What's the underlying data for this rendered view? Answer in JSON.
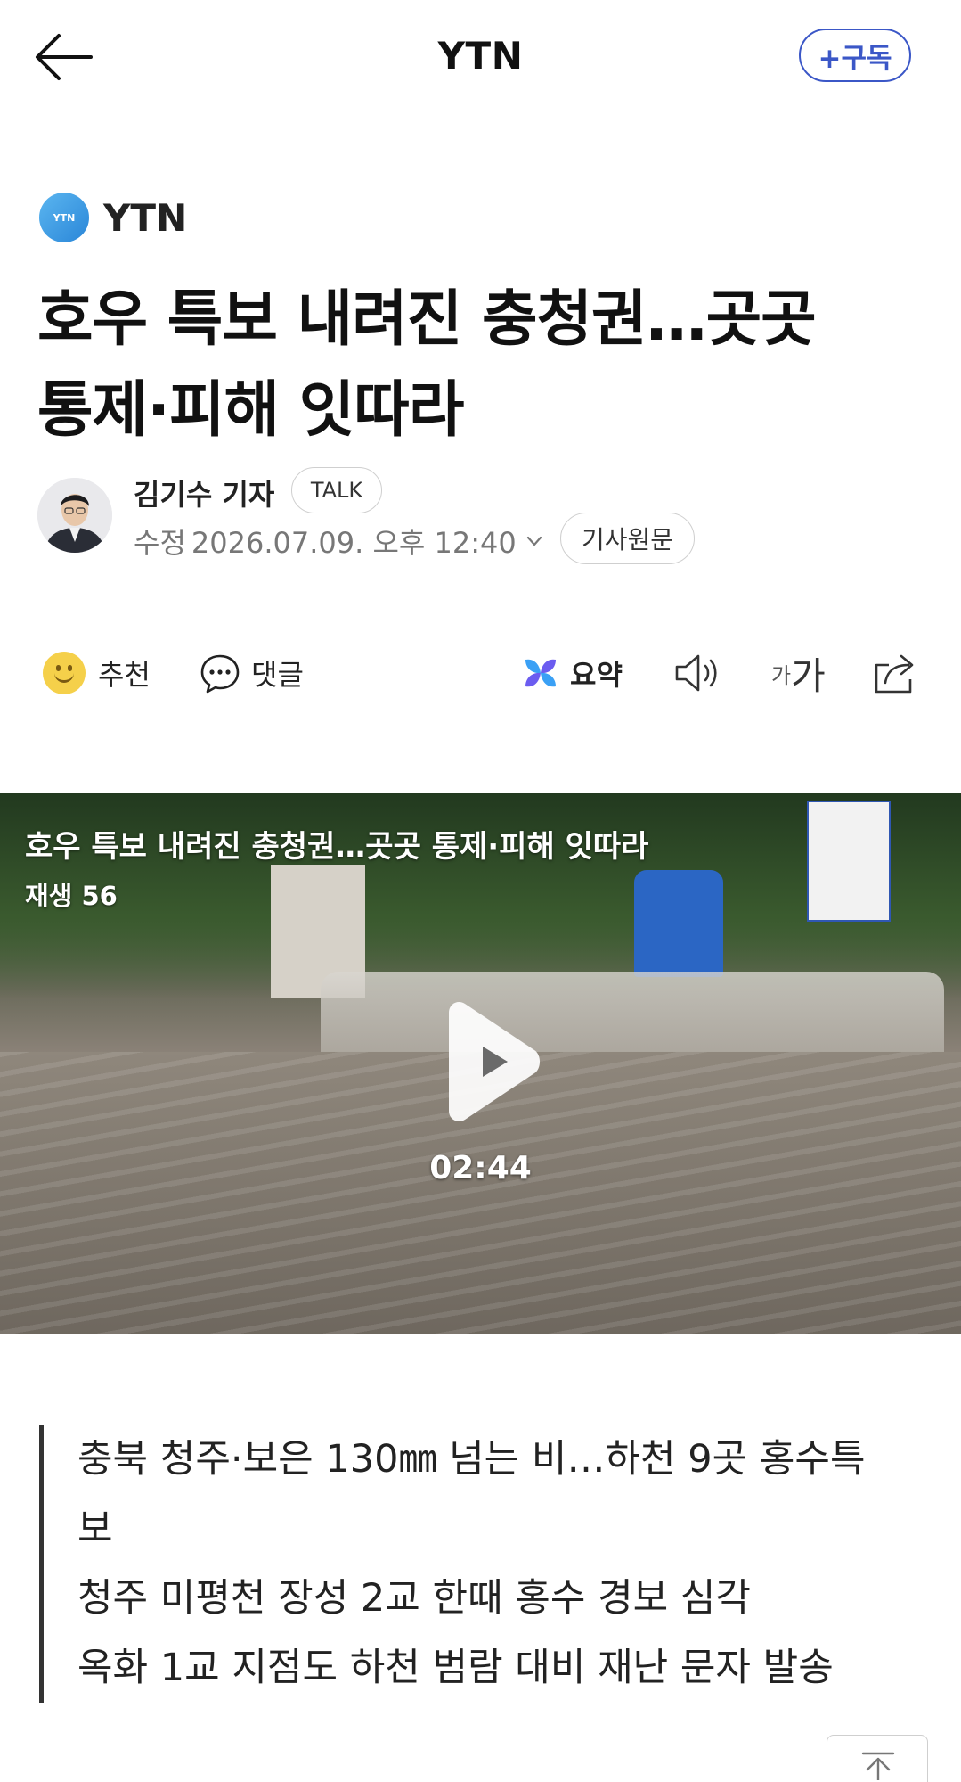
{
  "topbar": {
    "title": "YTN",
    "subscribe_label": "+구독"
  },
  "press": {
    "logo_text": "YTN",
    "name": "YTN"
  },
  "article": {
    "headline_line1": "호우 특보 내려진 충청권…곳곳",
    "headline_line2": "통제·피해 잇따라",
    "author": "김기수 기자",
    "talk_label": "TALK",
    "modified_label": "수정",
    "modified_time": "2026.07.09. 오후 12:40",
    "original_label": "기사원문"
  },
  "actions": {
    "recommend": "추천",
    "comment": "댓글",
    "summary": "요약",
    "font_small": "가",
    "font_big": "가"
  },
  "video": {
    "title": "호우 특보 내려진 충청권…곳곳 통제·피해 잇따라",
    "views": "재생 56",
    "duration": "02:44"
  },
  "summary": {
    "lines": [
      "충북 청주·보은 130㎜ 넘는 비…하천 9곳 홍수특",
      "보",
      "청주 미평천 장성 2교 한때 홍수 경보 심각",
      "옥화 1교 지점도 하천 범람 대비 재난 문자 발송"
    ]
  },
  "icons": {
    "back": "arrow-left-icon",
    "chevron": "chevron-down-icon",
    "smile": "smile-icon",
    "comment": "speech-bubble-icon",
    "summary": "ai-summary-icon",
    "speaker": "speaker-icon",
    "share": "share-icon",
    "play": "play-icon",
    "scroll_top": "arrow-up-icon"
  },
  "colors": {
    "accent": "#3b57c7",
    "summary_bar": "#333333"
  }
}
